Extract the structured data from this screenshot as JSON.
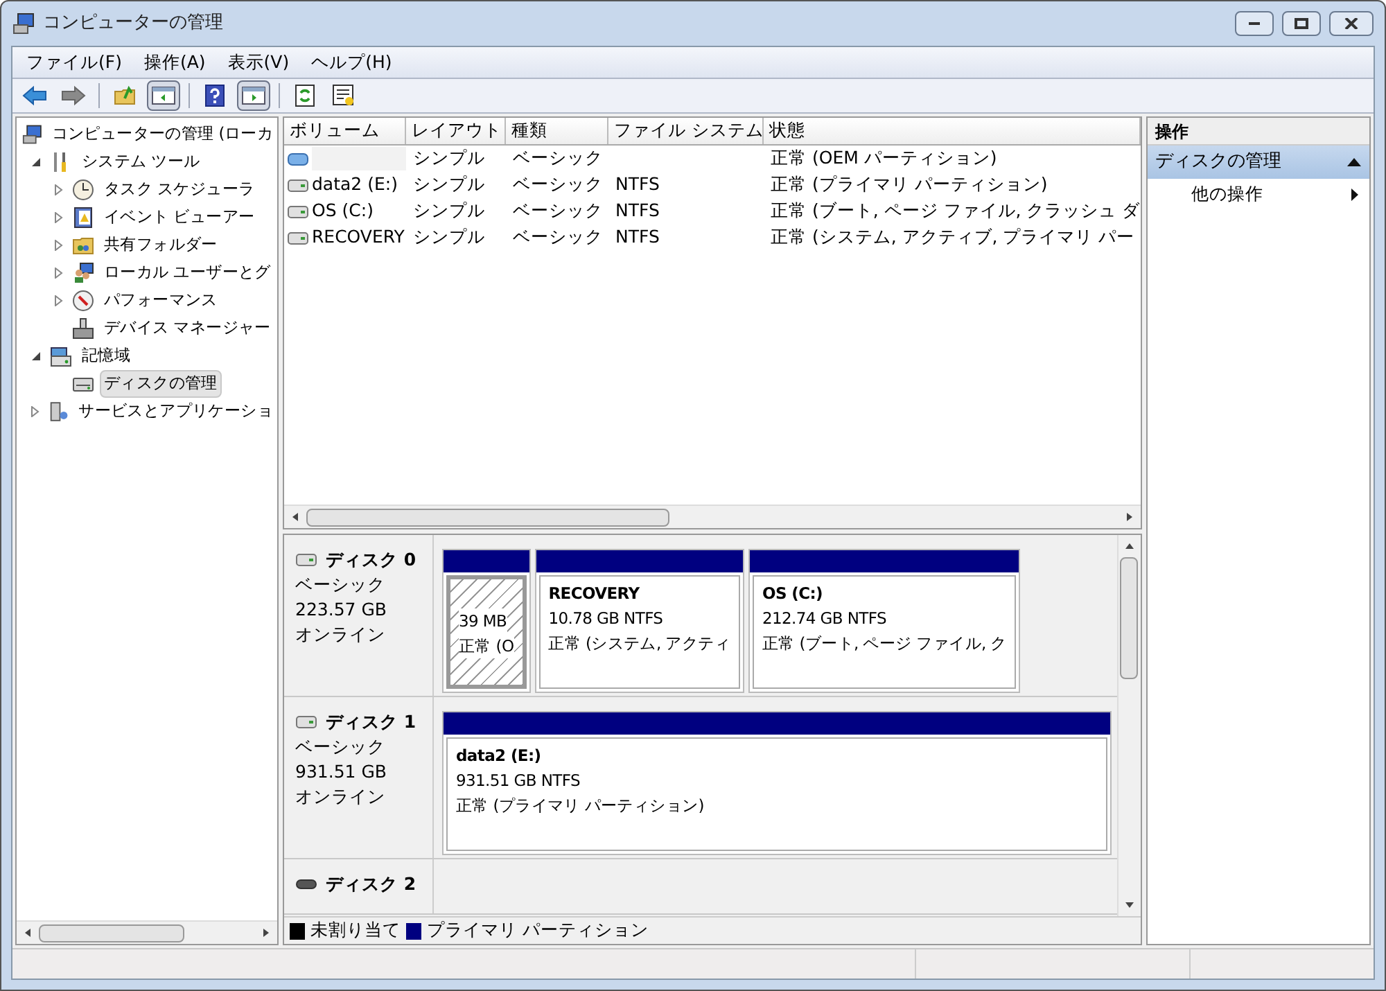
{
  "window": {
    "title": "コンピューターの管理"
  },
  "menu": [
    "ファイル(F)",
    "操作(A)",
    "表示(V)",
    "ヘルプ(H)"
  ],
  "toolbar": [
    [
      {
        "kind": "back",
        "pressed": false
      },
      {
        "kind": "forward",
        "pressed": false
      }
    ],
    [
      {
        "kind": "up",
        "pressed": false
      },
      {
        "kind": "tree-toggle",
        "pressed": true
      }
    ],
    [
      {
        "kind": "help",
        "pressed": false
      },
      {
        "kind": "pane-toggle",
        "pressed": true
      }
    ],
    [
      {
        "kind": "refresh",
        "pressed": false
      },
      {
        "kind": "export",
        "pressed": false
      }
    ]
  ],
  "tree": [
    {
      "label": "コンピューターの管理 (ローカ",
      "kind": "computer",
      "selected": false,
      "children": [
        {
          "label": "システム ツール",
          "kind": "tools",
          "expanded": true,
          "selected": false,
          "children": [
            {
              "label": "タスク スケジューラ",
              "kind": "clock",
              "expanded": false,
              "selected": false
            },
            {
              "label": "イベント ビューアー",
              "kind": "log",
              "expanded": false,
              "selected": false
            },
            {
              "label": "共有フォルダー",
              "kind": "folder",
              "expanded": false,
              "selected": false
            },
            {
              "label": "ローカル ユーザーとグ",
              "kind": "users",
              "expanded": false,
              "selected": false
            },
            {
              "label": "パフォーマンス",
              "kind": "gauge",
              "expanded": false,
              "selected": false
            },
            {
              "label": "デバイス マネージャー",
              "kind": "device",
              "selected": false
            }
          ]
        },
        {
          "label": "記憶域",
          "kind": "storage",
          "expanded": true,
          "selected": false,
          "children": [
            {
              "label": "ディスクの管理",
              "kind": "disk",
              "selected": true
            }
          ]
        },
        {
          "label": "サービスとアプリケーショ",
          "kind": "server",
          "expanded": false,
          "selected": false
        }
      ]
    }
  ],
  "volumes": {
    "columns": [
      "ボリューム",
      "レイアウト",
      "種類",
      "ファイル システム",
      "状態"
    ],
    "rows": [
      {
        "kind": "oem",
        "layout": "シンプル",
        "type": "ベーシック",
        "status": "正常 (OEM パーティション)"
      },
      {
        "kind": "drive",
        "volume": "data2 (E:)",
        "layout": "シンプル",
        "type": "ベーシック",
        "filesystem": "NTFS",
        "status": "正常 (プライマリ パーティション)"
      },
      {
        "kind": "drive",
        "volume": "OS (C:)",
        "layout": "シンプル",
        "type": "ベーシック",
        "filesystem": "NTFS",
        "status": "正常 (ブート, ページ ファイル, クラッシュ ダ"
      },
      {
        "kind": "drive",
        "volume": "RECOVERY",
        "layout": "シンプル",
        "type": "ベーシック",
        "filesystem": "NTFS",
        "status": "正常 (システム, アクティブ, プライマリ パー"
      }
    ]
  },
  "disks": [
    {
      "name": "ディスク 0",
      "type": "ベーシック",
      "size": "223.57 GB",
      "status": "オンライン",
      "kind": "fixed",
      "partitions": [
        {
          "size": "39 MB",
          "status": "正常 (O",
          "selected": true
        },
        {
          "name": "RECOVERY",
          "size": "10.78 GB NTFS",
          "status": "正常 (システム, アクティ",
          "selected": false
        },
        {
          "name": "OS  (C:)",
          "size": "212.74 GB NTFS",
          "status": "正常 (ブート, ページ ファイル, ク",
          "selected": false
        }
      ]
    },
    {
      "name": "ディスク 1",
      "type": "ベーシック",
      "size": "931.51 GB",
      "status": "オンライン",
      "kind": "fixed",
      "partitions": [
        {
          "name": "data2  (E:)",
          "size": "931.51 GB NTFS",
          "status": "正常 (プライマリ パーティション)",
          "selected": false
        }
      ]
    },
    {
      "name": "ディスク 2",
      "kind": "removable"
    }
  ],
  "legend": [
    {
      "label": "未割り当て",
      "color": "#000000"
    },
    {
      "label": "プライマリ パーティション",
      "color": "#000080"
    }
  ],
  "actions": {
    "title": "操作",
    "section": {
      "label": "ディスクの管理",
      "expanded": true
    },
    "items": [
      "他の操作"
    ]
  }
}
